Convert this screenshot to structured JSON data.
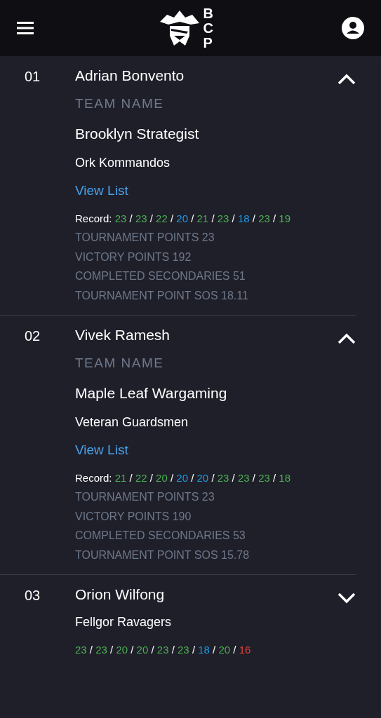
{
  "header": {
    "logo_text": "BCP"
  },
  "players": [
    {
      "rank": "01",
      "name": "Adrian Bonvento",
      "expanded": true,
      "team_label": "TEAM NAME",
      "team": "Brooklyn Strategist",
      "faction": "Ork Kommandos",
      "view_list": "View List",
      "record_label": "Record:",
      "separator": "/",
      "record": [
        {
          "score": "23",
          "color": "#4cb151"
        },
        {
          "score": "23",
          "color": "#4cb151"
        },
        {
          "score": "22",
          "color": "#4cb151"
        },
        {
          "score": "20",
          "color": "#1e9be0"
        },
        {
          "score": "21",
          "color": "#4cb151"
        },
        {
          "score": "23",
          "color": "#4cb151"
        },
        {
          "score": "18",
          "color": "#1e9be0"
        },
        {
          "score": "23",
          "color": "#4cb151"
        },
        {
          "score": "19",
          "color": "#4cb151"
        }
      ],
      "stats": [
        "TOURNAMENT POINTS 23",
        "VICTORY POINTS 192",
        "COMPLETED SECONDARIES 51",
        "TOURNAMENT POINT SOS 18.11"
      ]
    },
    {
      "rank": "02",
      "name": "Vivek Ramesh",
      "expanded": true,
      "team_label": "TEAM NAME",
      "team": "Maple Leaf Wargaming",
      "faction": "Veteran Guardsmen",
      "view_list": "View List",
      "record_label": "Record:",
      "separator": "/",
      "record": [
        {
          "score": "21",
          "color": "#4cb151"
        },
        {
          "score": "22",
          "color": "#4cb151"
        },
        {
          "score": "20",
          "color": "#4cb151"
        },
        {
          "score": "20",
          "color": "#1e9be0"
        },
        {
          "score": "20",
          "color": "#1e9be0"
        },
        {
          "score": "23",
          "color": "#4cb151"
        },
        {
          "score": "23",
          "color": "#4cb151"
        },
        {
          "score": "23",
          "color": "#4cb151"
        },
        {
          "score": "18",
          "color": "#4cb151"
        }
      ],
      "stats": [
        "TOURNAMENT POINTS 23",
        "VICTORY POINTS 190",
        "COMPLETED SECONDARIES 53",
        "TOURNAMENT POINT SOS 15.78"
      ]
    },
    {
      "rank": "03",
      "name": "Orion Wilfong",
      "expanded": false,
      "faction": "Fellgor Ravagers",
      "separator": "/",
      "record": [
        {
          "score": "23",
          "color": "#4cb151"
        },
        {
          "score": "23",
          "color": "#4cb151"
        },
        {
          "score": "20",
          "color": "#4cb151"
        },
        {
          "score": "20",
          "color": "#4cb151"
        },
        {
          "score": "23",
          "color": "#4cb151"
        },
        {
          "score": "23",
          "color": "#4cb151"
        },
        {
          "score": "18",
          "color": "#1e9be0"
        },
        {
          "score": "20",
          "color": "#4cb151"
        },
        {
          "score": "16",
          "color": "#e0443a"
        }
      ]
    }
  ]
}
